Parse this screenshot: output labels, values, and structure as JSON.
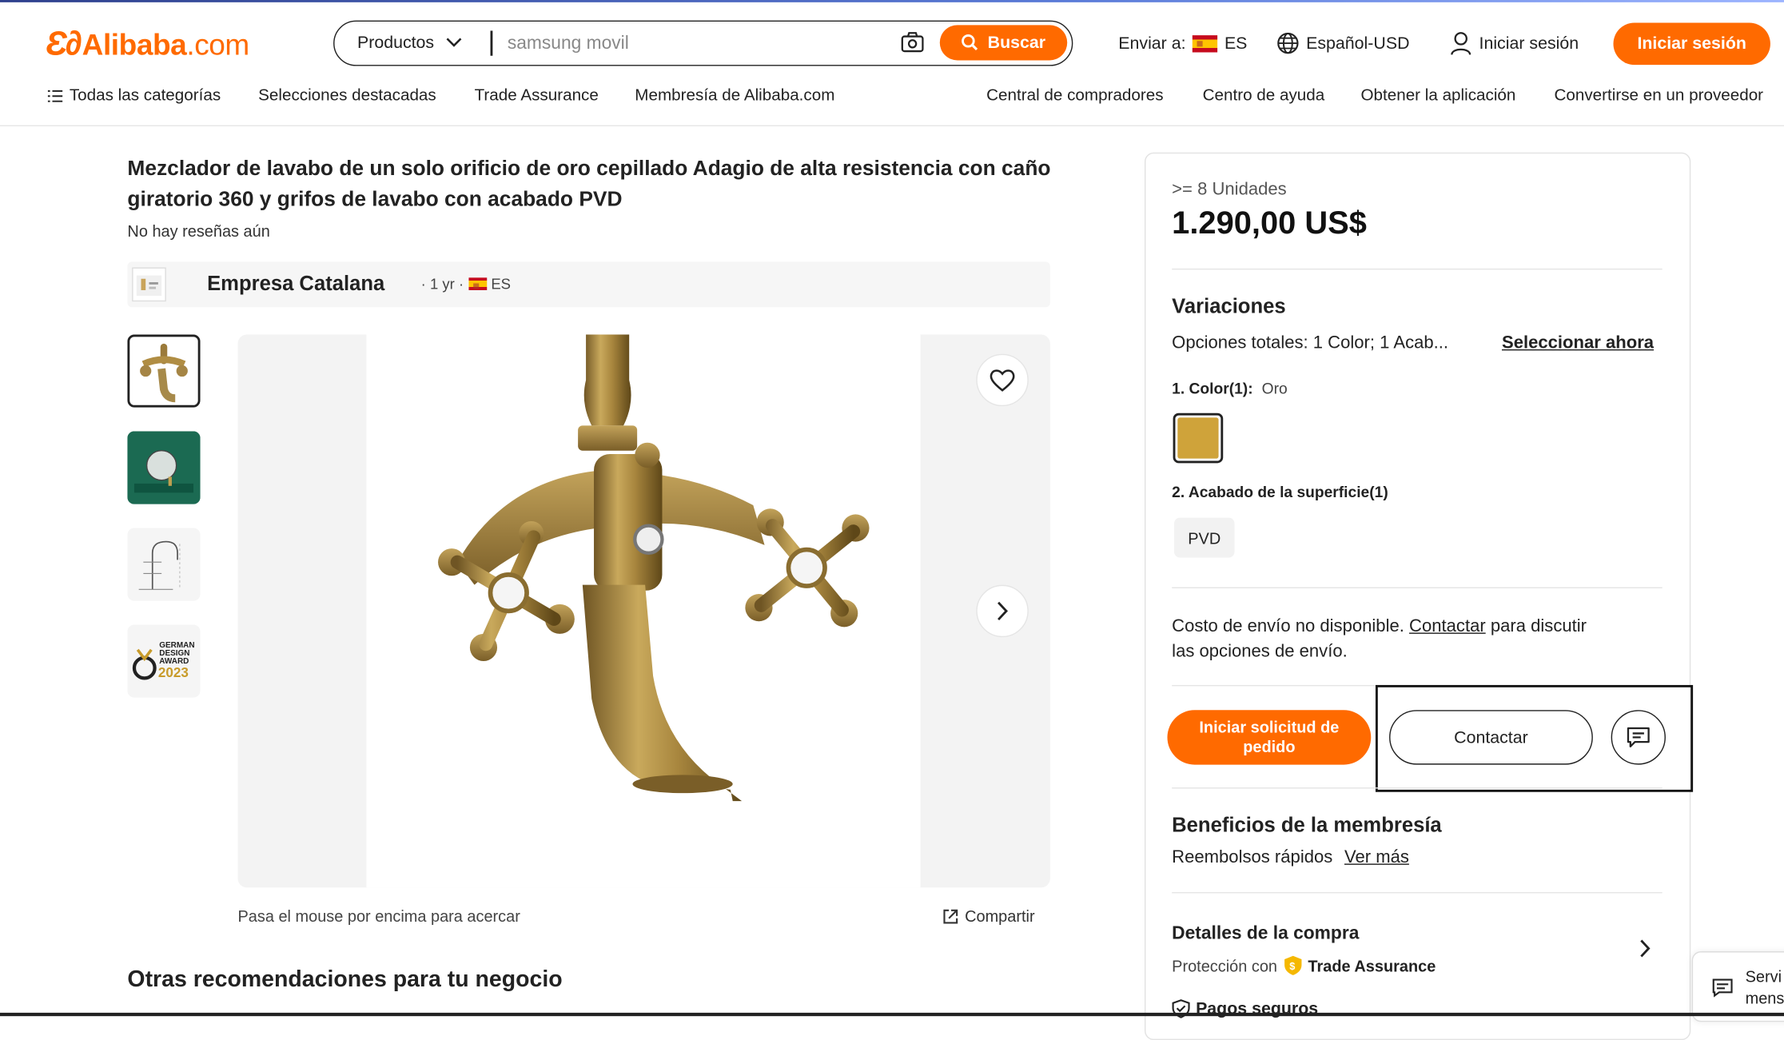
{
  "header": {
    "logo_mark": "Ɛ∂",
    "logo_text": "Alibaba",
    "logo_domain": ".com",
    "search": {
      "category": "Productos",
      "placeholder": "samsung movil",
      "button": "Buscar"
    },
    "ship_to_label": "Enviar a:",
    "ship_to_country": "ES",
    "language": "Español-USD",
    "sign_in_link": "Iniciar sesión",
    "sign_in_button": "Iniciar sesión"
  },
  "nav": {
    "all_categories": "Todas las categorías",
    "featured": "Selecciones destacadas",
    "trade_assurance": "Trade Assurance",
    "membership": "Membresía de Alibaba.com",
    "buyer_central": "Central de compradores",
    "help_center": "Centro de ayuda",
    "get_app": "Obtener la aplicación",
    "become_supplier": "Convertirse en un proveedor"
  },
  "product": {
    "title": "Mezclador de lavabo de un solo orificio de oro cepillado Adagio de alta resistencia con caño giratorio 360 y grifos de lavabo con acabado PVD",
    "reviews": "No hay reseñas aún",
    "supplier_name": "Empresa Catalana",
    "supplier_years": "· 1 yr ·",
    "supplier_country": "ES",
    "thumbnails": [
      {
        "label": "grifo dorado"
      },
      {
        "label": "lavabo verde"
      },
      {
        "label": "plano técnico"
      },
      {
        "label": "GERMAN DESIGN AWARD 2023",
        "award_lines": [
          "GERMAN",
          "DESIGN",
          "AWARD",
          "2023"
        ]
      }
    ],
    "zoom_hint": "Pasa el mouse por encima para acercar",
    "share": "Compartir",
    "recommendations_title": "Otras recomendaciones para tu negocio"
  },
  "purchase": {
    "min_qty": ">= 8 Unidades",
    "price": "1.290,00 US$",
    "variations_title": "Variaciones",
    "options_summary": "Opciones totales: 1 Color; 1 Acab...",
    "select_now": "Seleccionar ahora",
    "color_label": "1. Color(1):",
    "color_value": "Oro",
    "color_swatch": "#cfa33a",
    "finish_label": "2. Acabado de la superficie(1)",
    "finish_value": "PVD",
    "shipping_prefix": "Costo de envío no disponible.",
    "shipping_link": "Contactar",
    "shipping_suffix_1": "para discutir",
    "shipping_suffix_2": "las opciones de envío.",
    "order_button_line1": "Iniciar solicitud de",
    "order_button_line2": "pedido",
    "contact_button": "Contactar",
    "benefits_title": "Beneficios de la membresía",
    "benefits_text": "Reembolsos rápidos",
    "benefits_link": "Ver más",
    "purchase_details": "Detalles de la compra",
    "protection_prefix": "Protección con",
    "protection_brand": "Trade Assurance",
    "secure_payments": "Pagos seguros"
  },
  "floating": {
    "line1": "Servi",
    "line2": "mens"
  },
  "colors": {
    "brand": "#ff6a00",
    "gold": "#cfa33a"
  }
}
